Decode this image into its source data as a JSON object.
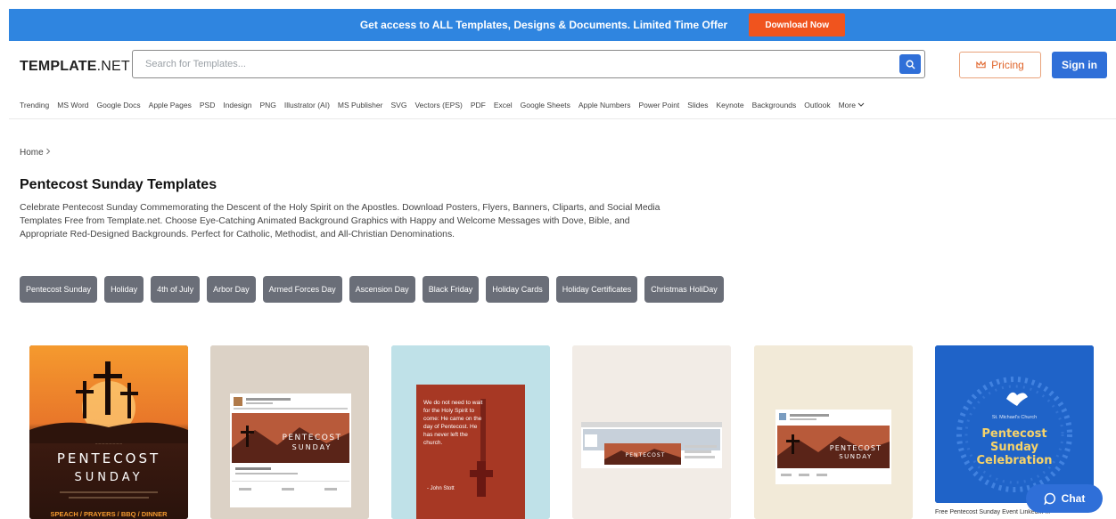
{
  "promo": {
    "text": "Get access to ALL Templates, Designs & Documents. Limited Time Offer",
    "button": "Download Now"
  },
  "header": {
    "logo_bold": "TEMPLATE",
    "logo_rest": ".NET",
    "search_placeholder": "Search for Templates...",
    "pricing": "Pricing",
    "signin": "Sign in"
  },
  "nav": [
    "Trending",
    "MS Word",
    "Google Docs",
    "Apple Pages",
    "PSD",
    "Indesign",
    "PNG",
    "Illustrator (AI)",
    "MS Publisher",
    "SVG",
    "Vectors (EPS)",
    "PDF",
    "Excel",
    "Google Sheets",
    "Apple Numbers",
    "Power Point",
    "Slides",
    "Keynote",
    "Backgrounds",
    "Outlook",
    "More"
  ],
  "breadcrumb": "Home",
  "page_title": "Pentecost Sunday Templates",
  "description": "Celebrate Pentecost Sunday Commemorating the Descent of the Holy Spirit on the Apostles. Download Posters, Flyers, Banners, Cliparts, and Social Media Templates Free from Template.net. Choose Eye-Catching Animated Background Graphics with Happy and Welcome Messages with Dove, Bible, and Appropriate Red-Designed Backgrounds. Perfect for Catholic, Methodist, and All-Christian Denominations.",
  "tags": [
    "Pentecost Sunday",
    "Holiday",
    "4th of July",
    "Arbor Day",
    "Armed Forces Day",
    "Ascension Day",
    "Black Friday",
    "Holiday Cards",
    "Holiday Certificates",
    "Christmas HoliDay"
  ],
  "cards": {
    "c1": {
      "title1": "PENTECOST",
      "title2": "SUNDAY",
      "footer": "SPEACH / PRAYERS / BBQ / DINNER"
    },
    "c2": {
      "title1": "PENTECOST",
      "title2": "SUNDAY"
    },
    "c3": {
      "quote": "We do not need to wait for the Holy Spirit to come: He came on the day of Pentecost. He has never left the church.",
      "author": "- John Stott"
    },
    "c4": {
      "title": "PENTECOST"
    },
    "c5": {
      "title1": "PENTECOST",
      "title2": "SUNDAY"
    },
    "c6": {
      "church": "St. Michael's Church",
      "line1": "Pentecost",
      "line2": "Sunday",
      "line3": "Celebration",
      "caption": "Free Pentecost Sunday Event LinkedIn ..."
    }
  },
  "chat": "Chat",
  "colors": {
    "promo": "#2f85e0",
    "download": "#f0541e",
    "primary": "#2f6fd8",
    "tag": "#6a6e78"
  }
}
